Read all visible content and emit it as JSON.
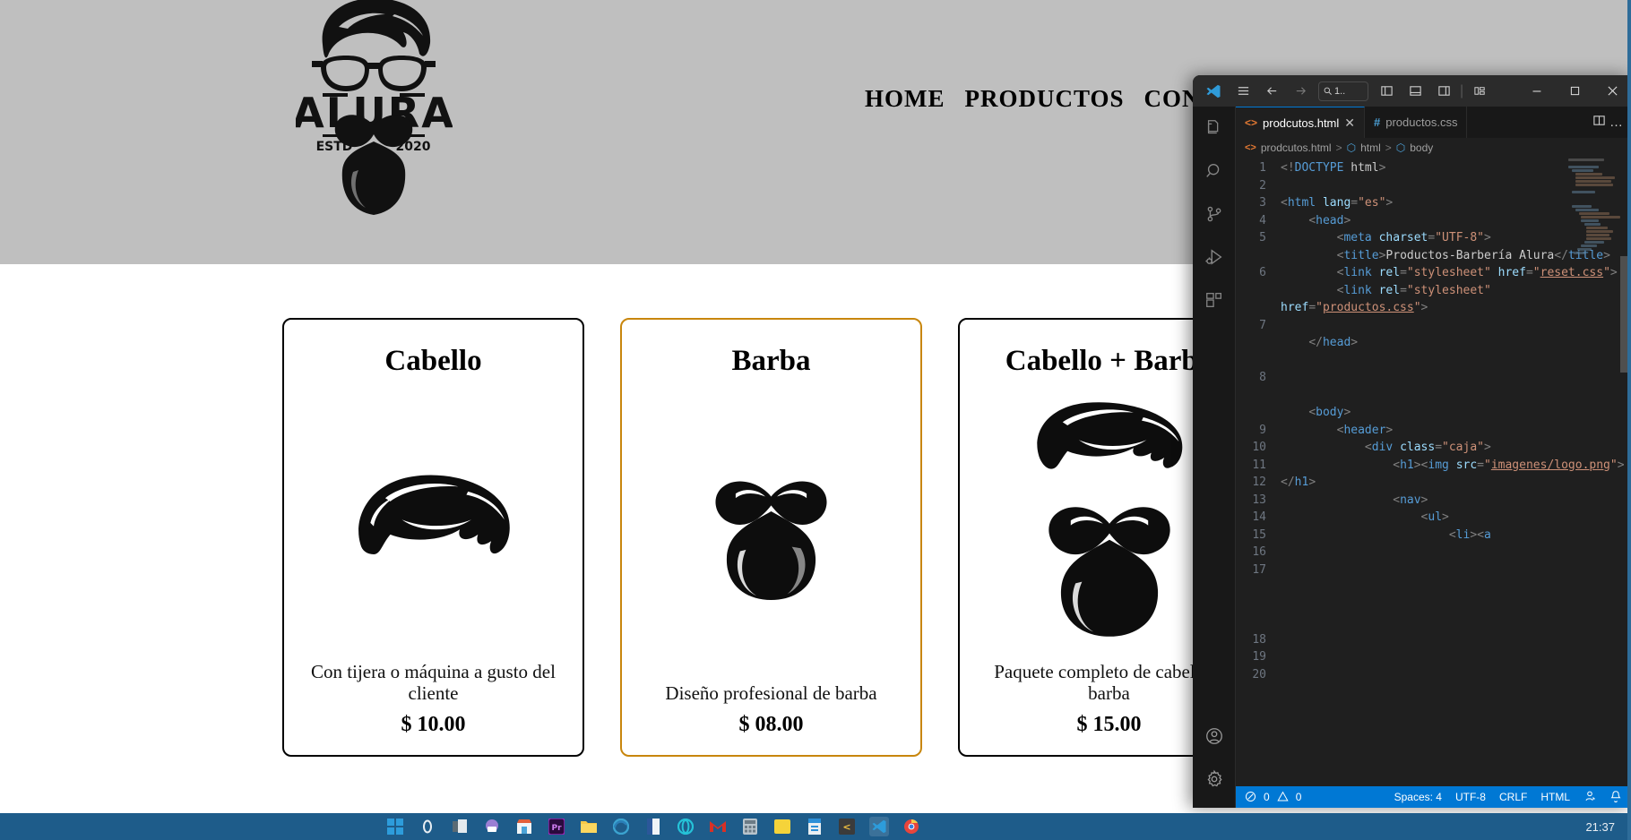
{
  "website": {
    "header": {
      "logo_alt": "ALURA ESTD 2020 barber logo",
      "logo_text_main": "ALURA",
      "logo_text_left": "ESTD",
      "logo_text_right": "2020",
      "nav": [
        {
          "label": "HOME"
        },
        {
          "label": "PRODUCTOS"
        },
        {
          "label": "CONT"
        }
      ]
    },
    "cards": [
      {
        "title": "Cabello",
        "icon": "hair-icon",
        "description": "Con tijera o máquina a gusto del cliente",
        "price": "$ 10.00",
        "highlighted": false
      },
      {
        "title": "Barba",
        "icon": "beard-icon",
        "description": "Diseño profesional de barba",
        "price": "$ 08.00",
        "highlighted": true
      },
      {
        "title": "Cabello + Barba",
        "icon": "hair-beard-icon",
        "description": "Paquete completo de cabello y barba",
        "price": "$ 15.00",
        "highlighted": false
      }
    ],
    "colors": {
      "header_bg": "#bfbfbf",
      "card_border": "#000000",
      "card_border_highlight": "#c8860d"
    }
  },
  "vscode": {
    "titlebar": {
      "app_icon": "vscode-logo-icon",
      "menu_icon": "hamburger-menu-icon",
      "back_icon": "arrow-left-icon",
      "forward_icon": "arrow-right-icon",
      "search_value": "1..",
      "search_icon": "magnifier-icon",
      "layout_icons": [
        "toggle-primary-sidebar-icon",
        "toggle-panel-icon",
        "toggle-secondary-sidebar-icon",
        "customize-layout-icon"
      ],
      "minimize_label": "–",
      "maximize_label": "▫",
      "close_label": "✕"
    },
    "activity_bar": [
      {
        "name": "explorer-icon"
      },
      {
        "name": "search-icon"
      },
      {
        "name": "source-control-icon"
      },
      {
        "name": "run-and-debug-icon"
      },
      {
        "name": "extensions-icon"
      },
      {
        "name": "accounts-icon"
      },
      {
        "name": "settings-gear-icon"
      }
    ],
    "tabs": [
      {
        "label": "prodcutos.html",
        "icon": "html-file-icon",
        "active": true,
        "close": "✕"
      },
      {
        "label": "productos.css",
        "icon": "css-file-icon",
        "active": false
      }
    ],
    "tab_actions": {
      "split_editor": "split-editor-icon",
      "more_actions": "…"
    },
    "breadcrumb": [
      {
        "label": "prodcutos.html",
        "icon": "html-file-icon"
      },
      {
        "label": "html",
        "icon": "symbol-cube-icon"
      },
      {
        "label": "body",
        "icon": "symbol-cube-icon"
      }
    ],
    "code_lines": [
      {
        "n": 1,
        "text": "<!DOCTYPE html>"
      },
      {
        "n": 2,
        "text": ""
      },
      {
        "n": 3,
        "text": "<html lang=\"es\">"
      },
      {
        "n": 4,
        "text": "    <head>"
      },
      {
        "n": 5,
        "text": "        <meta charset=\"UTF-8\">"
      },
      {
        "n": 6,
        "text": "        <title>Productos-Barbería Alura</title>"
      },
      {
        "n": 7,
        "text": "        <link rel=\"stylesheet\" href=\"reset.css\">"
      },
      {
        "n": 8,
        "text": "        <link rel=\"stylesheet\" href=\"productos.css\">"
      },
      {
        "n": 9,
        "text": ""
      },
      {
        "n": 10,
        "text": "    </head>"
      },
      {
        "n": 11,
        "text": ""
      },
      {
        "n": 12,
        "text": ""
      },
      {
        "n": 13,
        "text": ""
      },
      {
        "n": 14,
        "text": "    <body>"
      },
      {
        "n": 15,
        "text": "        <header>"
      },
      {
        "n": 16,
        "text": "            <div class=\"caja\">"
      },
      {
        "n": 17,
        "text": "                <h1><img src=\"imagenes/logo.png\"></h1>"
      },
      {
        "n": 18,
        "text": "                <nav>"
      },
      {
        "n": 19,
        "text": "                    <ul>"
      },
      {
        "n": 20,
        "text": "                        <li><a"
      }
    ],
    "status_bar": {
      "errors_icon": "error-circle-icon",
      "errors": "0",
      "warnings_icon": "warning-triangle-icon",
      "warnings": "0",
      "indentation": "Spaces: 4",
      "encoding": "UTF-8",
      "eol": "CRLF",
      "language": "HTML",
      "remote_icon": "account-feedback-icon",
      "bell_icon": "notifications-bell-icon",
      "accent_color": "#0078d4"
    }
  },
  "taskbar": {
    "clock": "21:37",
    "items": [
      {
        "name": "start-windows-icon",
        "color": "#2d9cdb"
      },
      {
        "name": "search-icon",
        "color": "#e8eef3"
      },
      {
        "name": "task-view-icon",
        "color": "#cfd8dd"
      },
      {
        "name": "copilot-icon",
        "color": "#9b7fd4"
      },
      {
        "name": "microsoft-store-icon",
        "color": "#e35f3a"
      },
      {
        "name": "premiere-pro-icon",
        "color": "#9b26b6"
      },
      {
        "name": "file-explorer-icon",
        "color": "#f7c948"
      },
      {
        "name": "microsoft-edge-icon",
        "color": "#3ba3d0"
      },
      {
        "name": "word-icon",
        "color": "#2b579a"
      },
      {
        "name": "opera-gx-icon",
        "color": "#25c3d8"
      },
      {
        "name": "gmail-icon",
        "color": "#d93025"
      },
      {
        "name": "calculator-icon",
        "color": "#b8c4cc"
      },
      {
        "name": "notes-icon",
        "color": "#f5d33a"
      },
      {
        "name": "onedrive-icon",
        "color": "#2c8fd8"
      },
      {
        "name": "brackets-icon",
        "color": "#4a4a4a"
      },
      {
        "name": "vscode-icon",
        "color": "#2d9cdb",
        "selected": true
      },
      {
        "name": "chrome-icon",
        "color": "#e8453c"
      }
    ]
  }
}
